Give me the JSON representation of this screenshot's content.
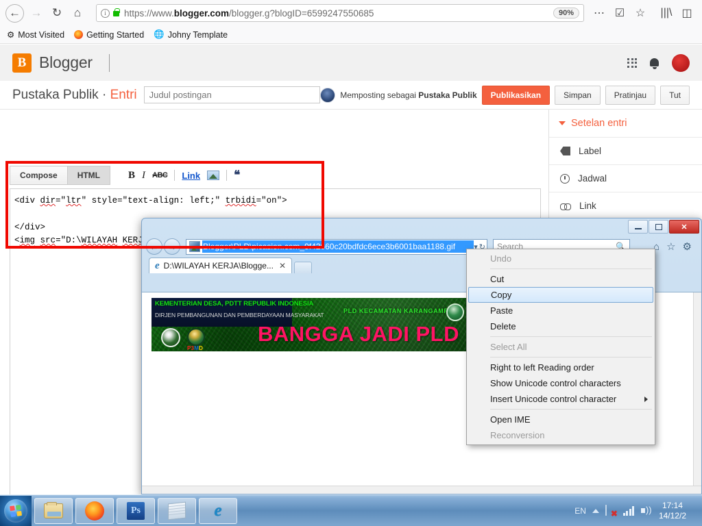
{
  "firefox": {
    "nav": {
      "back": "back-arrow",
      "forward": "forward-arrow",
      "reload": "reload",
      "home": "home"
    },
    "url_prefix": "https://www.",
    "url_bold": "blogger.com",
    "url_suffix": "/blogger.g?blogID=6599247550685",
    "zoom": "90%",
    "bookmarks": [
      {
        "label": "Most Visited",
        "icon": "gear-icon"
      },
      {
        "label": "Getting Started",
        "icon": "firefox-icon"
      },
      {
        "label": "Johny Template",
        "icon": "globe-icon"
      }
    ]
  },
  "blogger": {
    "wordmark": "Blogger",
    "logo_letter": "B",
    "breadcrumb_blog": "Pustaka Publik",
    "breadcrumb_sep": "·",
    "breadcrumb_section": "Entri",
    "title_placeholder": "Judul postingan",
    "title_value": "",
    "posting_as_prefix": "Memposting sebagai ",
    "posting_as_user": "Pustaka Publik",
    "buttons": {
      "publish": "Publikasikan",
      "save": "Simpan",
      "preview": "Pratinjau",
      "close": "Tut"
    },
    "editor": {
      "tab_compose": "Compose",
      "tab_html": "HTML",
      "tools": {
        "bold": "B",
        "italic": "I",
        "strike": "ABC",
        "link": "Link",
        "image": "image-icon",
        "quote": "“"
      },
      "code_line1": "<div dir=\"ltr\" style=\"text-align: left;\" trbidi=\"on\">",
      "code_line2": "",
      "code_line3": "</div>",
      "code_line4": "<img src=\"D:\\WILAYAH KERJA\\Blogger\\PLD\\picasion.com_9f42660c20bdfdc6ece3b6001baa1188.gif\">"
    },
    "settings": {
      "header": "Setelan entri",
      "items": [
        {
          "label": "Label",
          "icon": "tag-icon"
        },
        {
          "label": "Jadwal",
          "icon": "clock-icon"
        },
        {
          "label": "Link",
          "icon": "link-icon"
        }
      ]
    }
  },
  "ie_window": {
    "address_value": "Blogger\\PLD\\picasion.com_9f42660c20bdfdc6ece3b6001baa1188.gif",
    "search_placeholder": "Search",
    "tab_title": "D:\\WILAYAH KERJA\\Blogge...",
    "window_controls": {
      "minimize": "minimize",
      "maximize": "maximize",
      "close": "✕"
    },
    "toolbar_icons": [
      "home-icon",
      "favorites-star-icon",
      "tools-gear-icon"
    ],
    "banner": {
      "line1": "KEMENTERIAN DESA, PDTT REPUBLIK INDONESIA",
      "line2": "DIRJEN PEMBANGUNAN DAN PEMBERDAYAAN MASYARAKAT",
      "right_label": "PLD KECAMATAN KARANGAMPEL",
      "headline": "BANGGA JADI PLD",
      "p3md_p": "P3",
      "p3md_m": "M",
      "p3md_d": "D"
    }
  },
  "context_menu": {
    "items": [
      {
        "label": "Undo",
        "state": "disabled",
        "separator_after": true
      },
      {
        "label": "Cut",
        "state": "normal"
      },
      {
        "label": "Copy",
        "state": "selected"
      },
      {
        "label": "Paste",
        "state": "normal"
      },
      {
        "label": "Delete",
        "state": "normal",
        "separator_after": true
      },
      {
        "label": "Select All",
        "state": "disabled",
        "separator_after": true
      },
      {
        "label": "Right to left Reading order",
        "state": "normal"
      },
      {
        "label": "Show Unicode control characters",
        "state": "normal"
      },
      {
        "label": "Insert Unicode control character",
        "state": "submenu",
        "separator_after": true
      },
      {
        "label": "Open IME",
        "state": "normal"
      },
      {
        "label": "Reconversion",
        "state": "disabled"
      }
    ]
  },
  "taskbar": {
    "apps": [
      {
        "name": "file-explorer"
      },
      {
        "name": "firefox"
      },
      {
        "name": "photoshop",
        "label": "Ps"
      },
      {
        "name": "notepad"
      },
      {
        "name": "internet-explorer"
      }
    ],
    "language": "EN",
    "time": "17:14",
    "date": "14/12/2"
  },
  "colors": {
    "blogger_orange": "#f4603e",
    "redbox": "#f00800",
    "ie_selection_blue": "#3399ff",
    "banner_green": "#0a5c0a",
    "banner_pink": "#ff1464"
  }
}
